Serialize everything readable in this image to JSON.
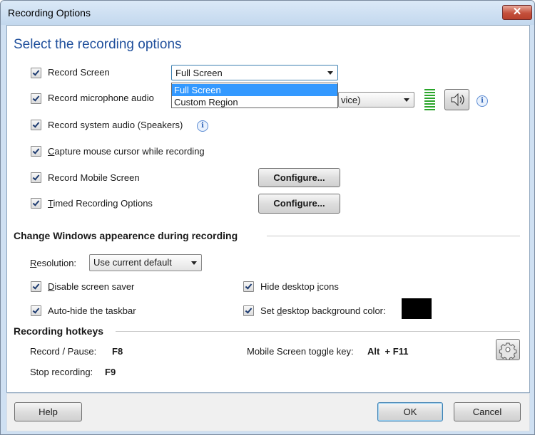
{
  "window": {
    "title": "Recording Options",
    "close_glyph": "✕"
  },
  "heading": "Select the recording options",
  "options": {
    "record_screen": {
      "label": "Record Screen",
      "checked": true
    },
    "screen_mode": {
      "selected": "Full Screen",
      "dropdown_open": true,
      "options": [
        "Full Screen",
        "Custom Region"
      ]
    },
    "record_microphone": {
      "label": "Record microphone audio",
      "checked": true
    },
    "microphone_device": "vice)",
    "record_system_audio": {
      "label": "Record system audio (Speakers)",
      "checked": true
    },
    "capture_cursor": {
      "label": "Capture mouse cursor while recording",
      "checked": true
    },
    "record_mobile": {
      "label": "Record Mobile Screen",
      "checked": true,
      "button": "Configure..."
    },
    "timed_recording": {
      "label": "Timed Recording Options",
      "checked": true,
      "button": "Configure..."
    },
    "info_glyph": "i"
  },
  "appearance": {
    "title": "Change Windows appearence during recording",
    "resolution_label": "Resolution:",
    "resolution_value": "Use current default",
    "disable_screensaver": {
      "label": "Disable screen saver",
      "checked": true
    },
    "hide_icons": {
      "label": "Hide desktop icons",
      "checked": true
    },
    "autohide_taskbar": {
      "label": "Auto-hide the taskbar",
      "checked": true
    },
    "set_background": {
      "label": "Set desktop background color:",
      "checked": true,
      "color": "#000000"
    }
  },
  "hotkeys": {
    "title": "Recording hotkeys",
    "record_pause_label": "Record / Pause:",
    "record_pause_key": "F8",
    "stop_label": "Stop recording:",
    "stop_key": "F9",
    "mobile_toggle_label": "Mobile Screen toggle key:",
    "mobile_toggle_key": "Alt  + F11"
  },
  "footer": {
    "help": "Help",
    "ok": "OK",
    "cancel": "Cancel"
  },
  "colors": {
    "heading": "#1f4f9c",
    "selection": "#3399ff",
    "meter": "#2aa52a",
    "close": "#c4503c"
  }
}
